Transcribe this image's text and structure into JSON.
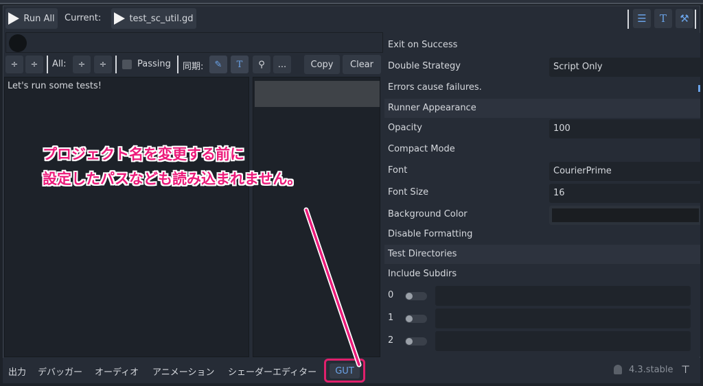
{
  "toolbar": {
    "run_all_label": "Run All",
    "current_label": "Current:",
    "current_file": "test_sc_util.gd",
    "right_icons": [
      "list-icon",
      "text-icon",
      "tools-icon"
    ]
  },
  "controls": {
    "all_label": "All:",
    "passing_label": "Passing",
    "sync_label": "同期:",
    "more_label": "...",
    "copy_label": "Copy",
    "clear_label": "Clear"
  },
  "output": {
    "text": "Let's run some tests!"
  },
  "inspector": {
    "exit_on_success": "Exit on Success",
    "double_strategy_label": "Double Strategy",
    "double_strategy_value": "Script Only",
    "errors_cause_failures": "Errors cause failures.",
    "runner_appearance": "Runner Appearance",
    "opacity_label": "Opacity",
    "opacity_value": "100",
    "compact_mode": "Compact Mode",
    "font_label": "Font",
    "font_value": "CourierPrime",
    "font_size_label": "Font Size",
    "font_size_value": "16",
    "background_color_label": "Background Color",
    "disable_formatting": "Disable Formatting",
    "test_directories": "Test Directories",
    "include_subdirs": "Include Subdirs",
    "dir_indices": [
      "0",
      "1",
      "2"
    ]
  },
  "bottom_tabs": {
    "output": "出力",
    "debugger": "デバッガー",
    "audio": "オーディオ",
    "animation": "アニメーション",
    "shader_editor": "シェーダーエディター",
    "gut": "GUT",
    "version": "4.3.stable"
  },
  "annotation": {
    "line1": "プロジェクト名を変更する前に",
    "line2": "設定したパスなども読み込まれません。",
    "color": "#ec1a7a"
  }
}
